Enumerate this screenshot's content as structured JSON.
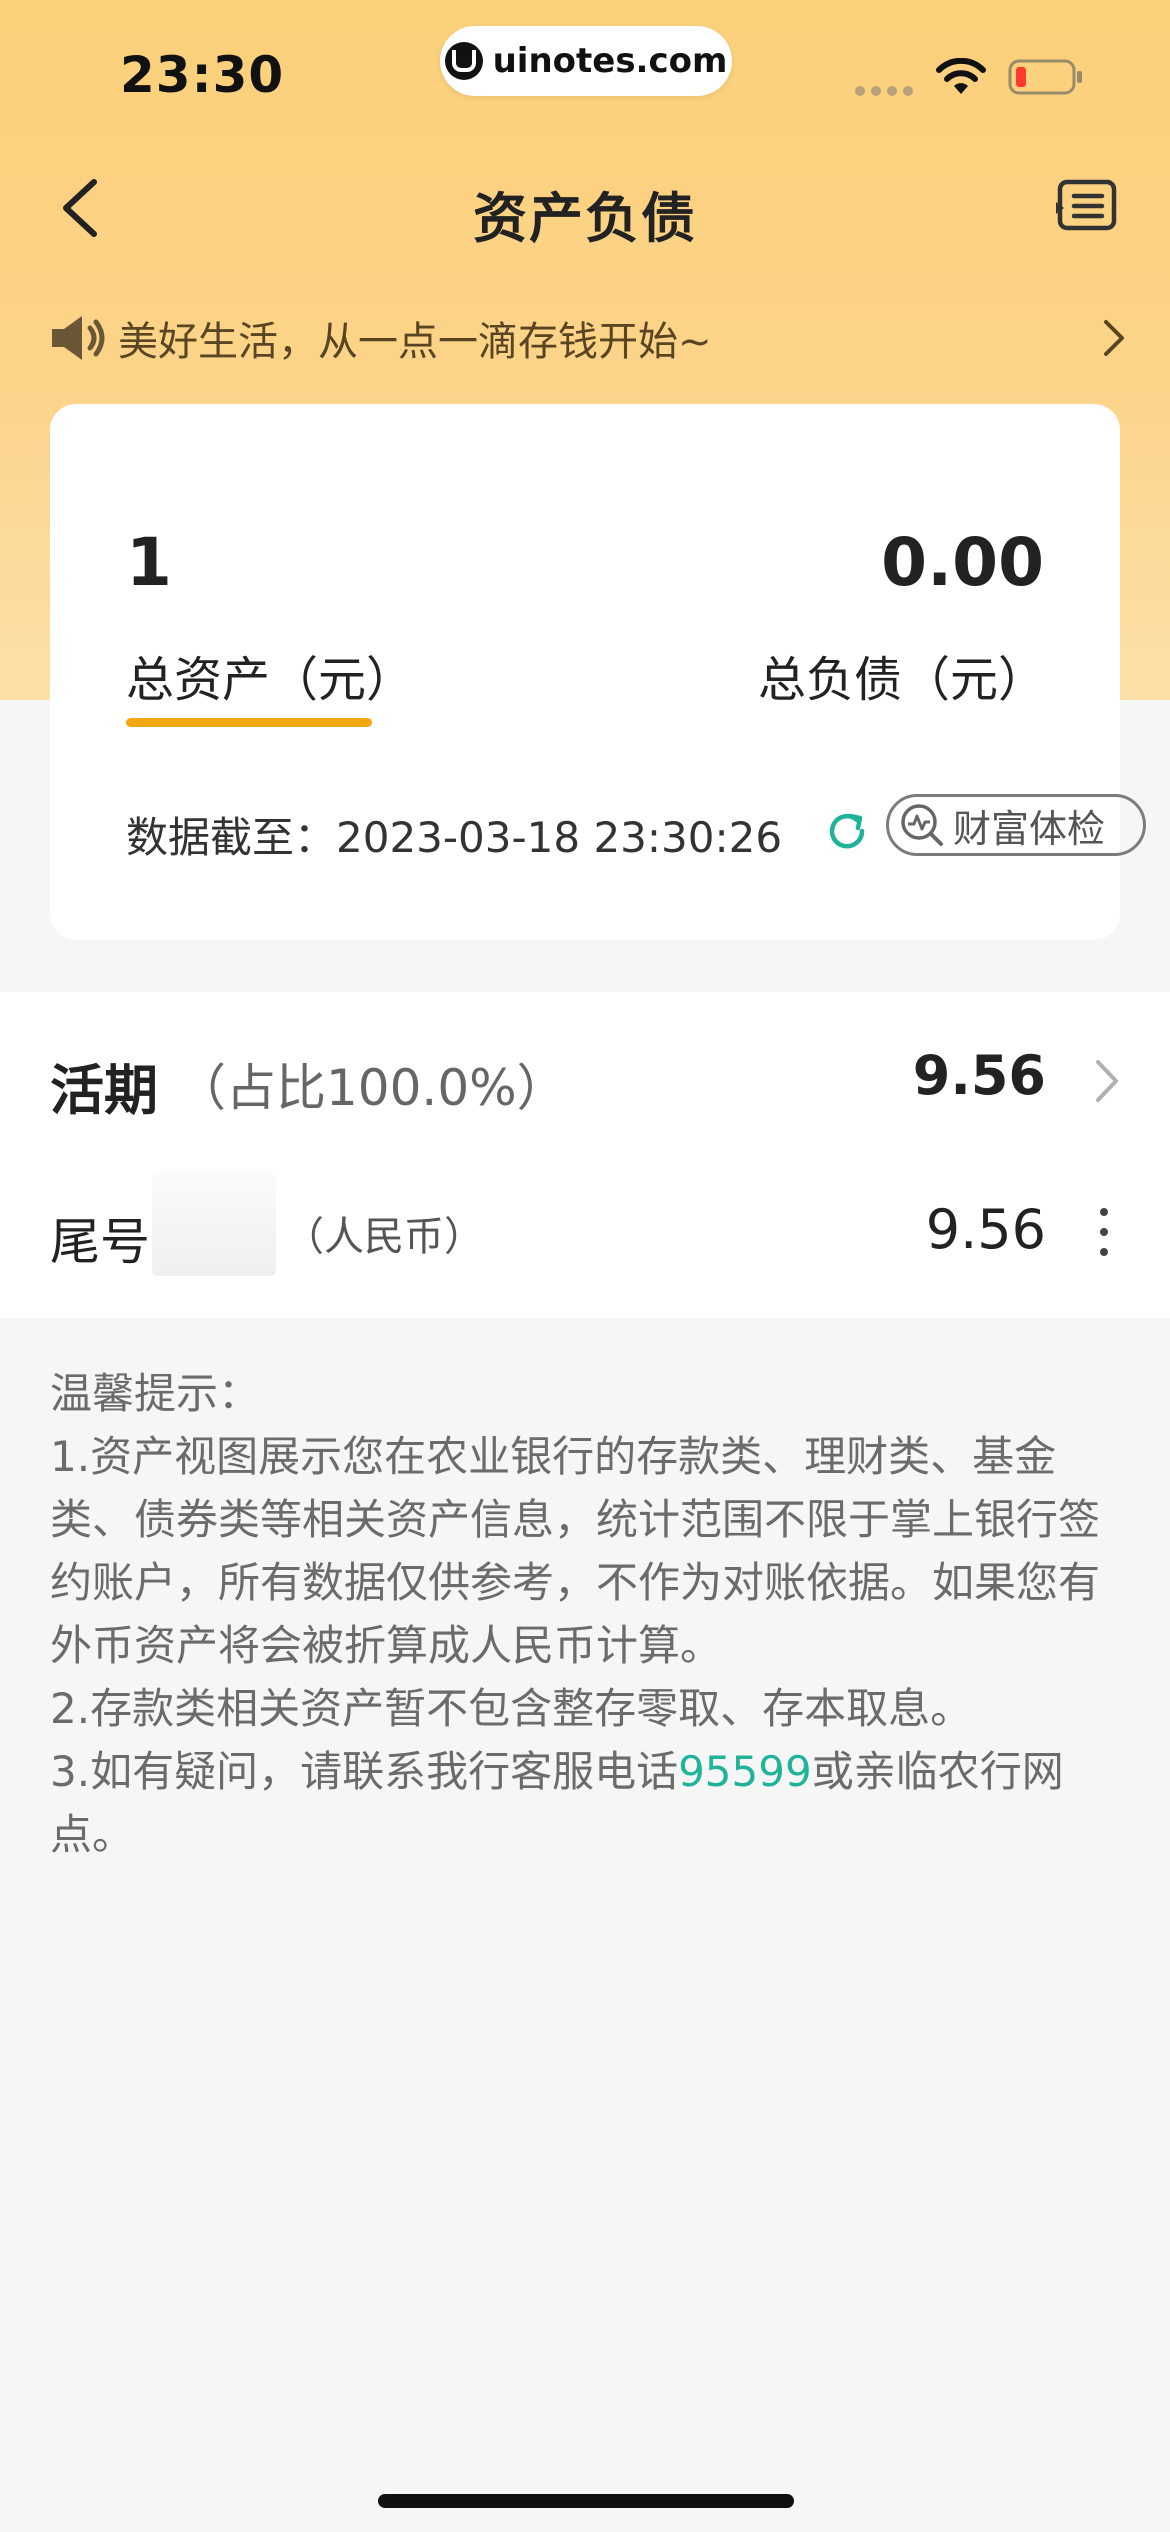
{
  "status_bar": {
    "time": "23:30",
    "site": "uinotes.com",
    "icons": [
      "signal-icon",
      "wifi-icon",
      "battery-low-icon"
    ],
    "battery_color": "#ff3b30"
  },
  "nav": {
    "title": "资产负债",
    "icons": [
      "back-arrow-icon",
      "statement-menu-icon"
    ]
  },
  "notice": {
    "text": "美好生活，从一点一滴存钱开始~",
    "icons": [
      "speaker-icon",
      "chevron-right-icon"
    ]
  },
  "summary": {
    "total_assets": "1",
    "total_assets_label": "总资产（元）",
    "total_liabilities": "0.00",
    "total_liabilities_label": "总负债（元）",
    "date_label": "数据截至：",
    "date_value": "2023-03-18 23:30:26",
    "wealth_check_label": "财富体检",
    "accent_color": "#f3a712",
    "icons": [
      "refresh-icon",
      "wealth-check-icon"
    ]
  },
  "demand": {
    "title": "活期",
    "ratio": "（占比100.0%）",
    "amount": "9.56"
  },
  "account": {
    "prefix": "尾号",
    "currency": "（人民币）",
    "amount": "9.56",
    "icons": [
      "more-vertical-icon"
    ]
  },
  "tips": {
    "title": "温馨提示：",
    "line1": "1.资产视图展示您在农业银行的存款类、理财类、基金类、债券类等相关资产信息，统计范围不限于掌上银行签约账户，所有数据仅供参考，不作为对账依据。如果您有外币资产将会被折算成人民币计算。",
    "line2": "2.存款类相关资产暂不包含整存零取、存本取息。",
    "line3_prefix": "3.如有疑问，请联系我行客服电话",
    "line3_phone": "95599",
    "line3_suffix": "或亲临农行网点。",
    "phone_color": "#1fb49a"
  }
}
